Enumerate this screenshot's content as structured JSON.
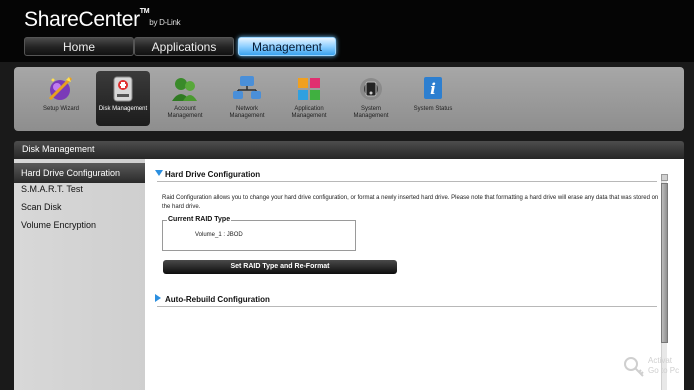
{
  "brand": {
    "name": "ShareCenter",
    "trademark": "TM",
    "byline": "by D-Link"
  },
  "nav": {
    "tabs": [
      {
        "label": "Home"
      },
      {
        "label": "Applications"
      },
      {
        "label": "Management"
      }
    ],
    "active": "Management"
  },
  "toolbar": {
    "items": [
      {
        "label": "Setup Wizard",
        "icon": "wizard-icon"
      },
      {
        "label": "Disk Management",
        "icon": "disk-management-icon",
        "active": true
      },
      {
        "label": "Account Management",
        "icon": "account-management-icon"
      },
      {
        "label": "Network Management",
        "icon": "network-management-icon"
      },
      {
        "label": "Application Management",
        "icon": "application-management-icon"
      },
      {
        "label": "System Management",
        "icon": "system-management-icon"
      },
      {
        "label": "System Status",
        "icon": "system-status-icon"
      }
    ]
  },
  "section": {
    "title": "Disk Management"
  },
  "sidebar": {
    "items": [
      {
        "label": "Hard Drive Configuration"
      },
      {
        "label": "S.M.A.R.T. Test"
      },
      {
        "label": "Scan Disk"
      },
      {
        "label": "Volume Encryption"
      }
    ],
    "active_index": 0
  },
  "content": {
    "hdc": {
      "title": "Hard Drive Configuration",
      "description": "Raid Configuration allows you to change your hard drive configuration, or format a newly inserted hard drive. Please note that formatting a hard drive will erase any data that was stored on the hard drive.",
      "raid_type_legend": "Current RAID Type",
      "volume_line": "Volume_1 : JBOD",
      "set_raid_button": "Set RAID Type and Re-Format"
    },
    "auto_rebuild": {
      "title": "Auto-Rebuild Configuration"
    }
  },
  "watermark": {
    "line1": "Activat",
    "line2": "Go to Pc"
  },
  "colors": {
    "accent_blue": "#2b8fe0",
    "active_tab": "#8fd0ff",
    "header_bg": "#050505"
  }
}
